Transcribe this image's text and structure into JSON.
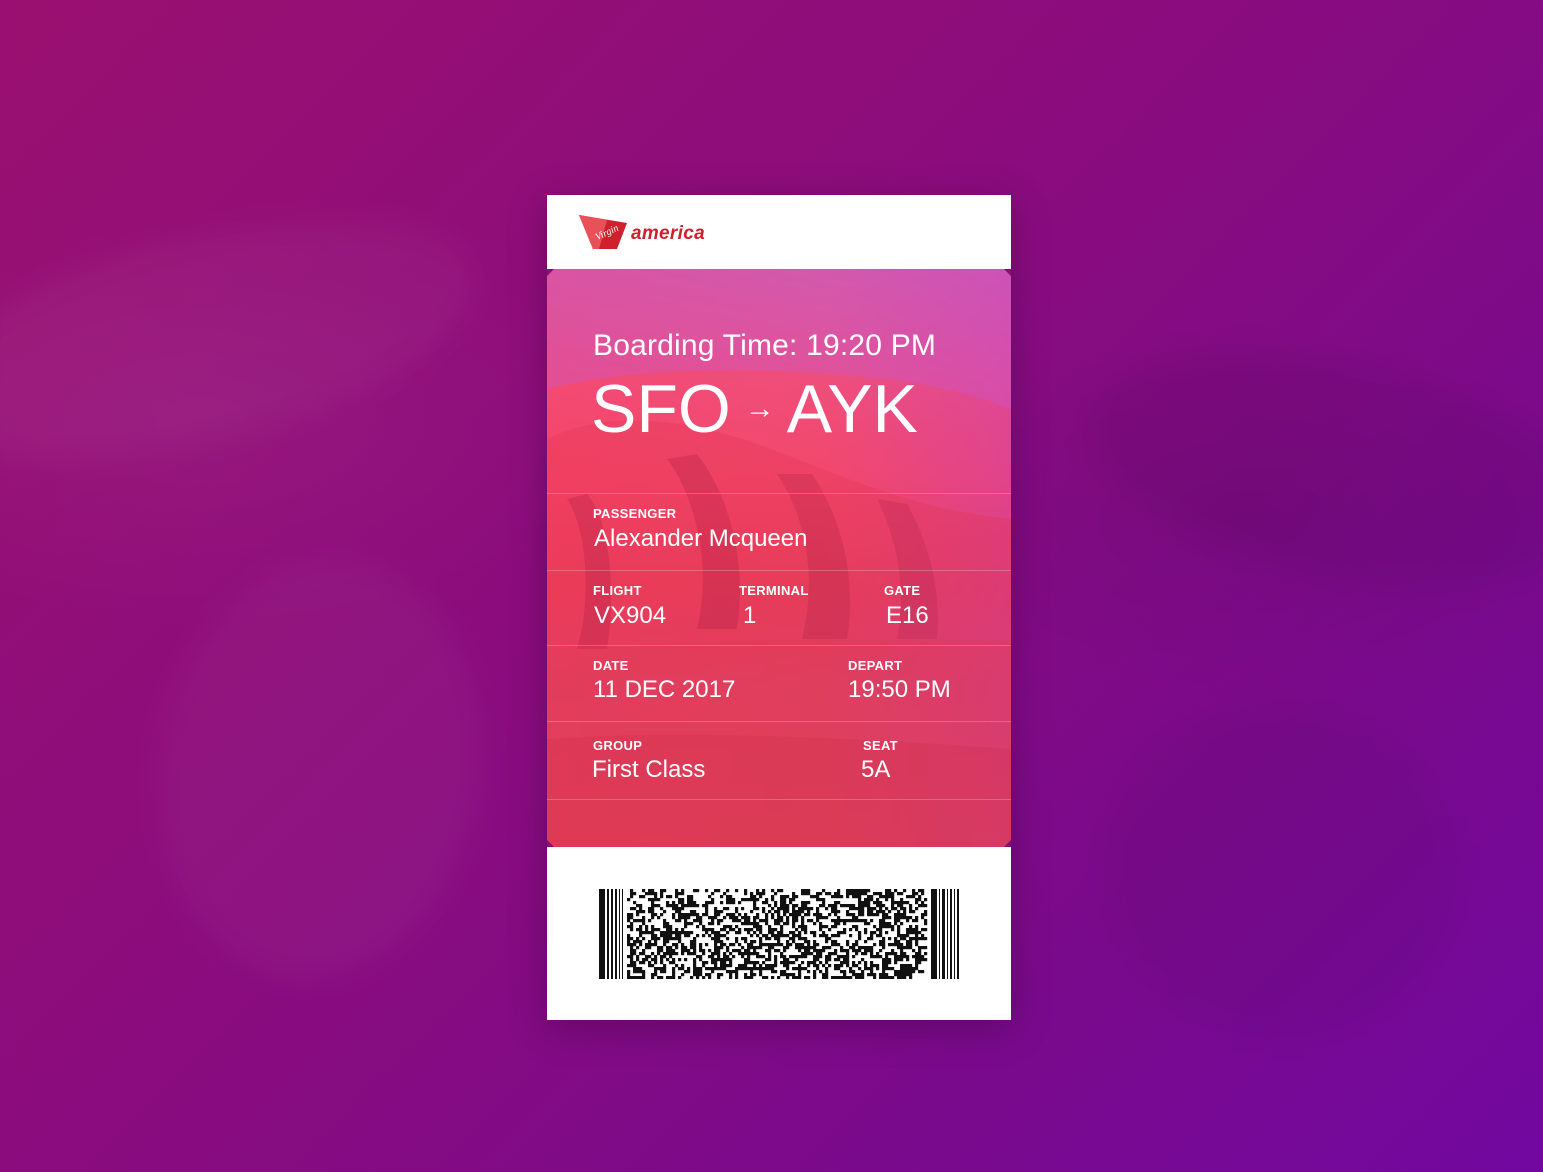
{
  "brand": {
    "name": "america",
    "tail_text": "Virgin",
    "color": "#d0202e"
  },
  "boarding": {
    "text": "Boarding Time: 19:20 PM"
  },
  "route": {
    "from": "SFO",
    "arrow": "→",
    "to": "AYK"
  },
  "passenger": {
    "label": "PASSENGER",
    "value": "Alexander Mcqueen"
  },
  "flight": {
    "label": "FLIGHT",
    "value": "VX904"
  },
  "terminal": {
    "label": "TERMINAL",
    "value": "1"
  },
  "gate": {
    "label": "GATE",
    "value": "E16"
  },
  "date": {
    "label": "DATE",
    "value": "11 DEC 2017"
  },
  "depart": {
    "label": "DEPART",
    "value": "19:50 PM"
  },
  "group": {
    "label": "GROUP",
    "value": "First Class"
  },
  "seat": {
    "label": "SEAT",
    "value": "5A"
  },
  "icons": {
    "logo": "virgin-tail-logo-icon",
    "barcode": "pdf417-barcode-icon"
  },
  "colors": {
    "background": "#8a0c7e",
    "ticket_gradient_top": "#d85a9a",
    "ticket_gradient_mid": "#f2476a"
  }
}
